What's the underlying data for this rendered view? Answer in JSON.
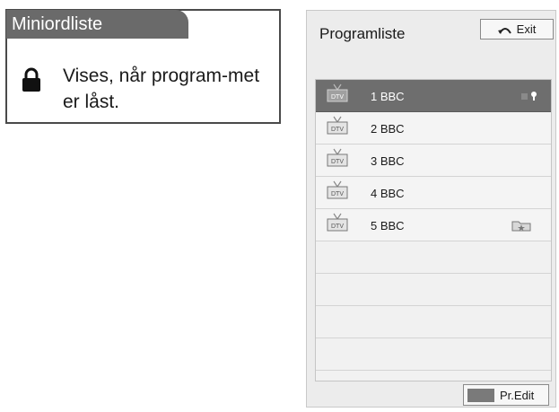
{
  "mini_glossary": {
    "title": "Miniordliste",
    "icon": "lock-icon",
    "description": "Vises, når program-met er låst."
  },
  "program_list": {
    "title": "Programliste",
    "exit_label": "Exit",
    "edit_label": "Pr.Edit",
    "channels": [
      {
        "badge": "DTV",
        "label": "1 BBC",
        "selected": true,
        "indicator": "lock-icon"
      },
      {
        "badge": "DTV",
        "label": "2 BBC",
        "selected": false,
        "indicator": ""
      },
      {
        "badge": "DTV",
        "label": "3 BBC",
        "selected": false,
        "indicator": ""
      },
      {
        "badge": "DTV",
        "label": "4 BBC",
        "selected": false,
        "indicator": ""
      },
      {
        "badge": "DTV",
        "label": "5 BBC",
        "selected": false,
        "indicator": "favorite-folder-icon"
      }
    ],
    "colors": {
      "selected_row": "#6e6e6e",
      "edit_swatch": "#7a7a7a"
    }
  }
}
